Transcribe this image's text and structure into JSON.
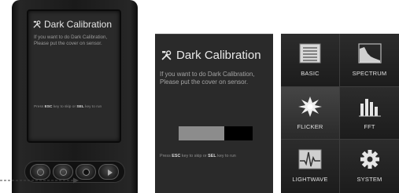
{
  "device_screen": {
    "title": "Dark  Calibration",
    "message": "If you want to do Dark Calibration, Please put the cover on sensor.",
    "hint": {
      "press": "Press ",
      "esc_key": "ESC",
      "middle": " key to skip or ",
      "sel_key": "SEL",
      "end": " key to run"
    }
  },
  "calibration_panel": {
    "title": "Dark  Calibration",
    "message": "If you want to do Dark Calibration, Please put the cover on sensor.",
    "progress": 0.62,
    "hint": {
      "press": "Press ",
      "esc_key": "ESC",
      "middle": " key to skip or ",
      "sel_key": "SEL",
      "end": " key to run"
    }
  },
  "menu": {
    "items": [
      {
        "label": "BASIC",
        "icon": "list-icon"
      },
      {
        "label": "SPECTRUM",
        "icon": "spectrum-icon"
      },
      {
        "label": "FLICKER",
        "icon": "flicker-icon"
      },
      {
        "label": "FFT",
        "icon": "fft-icon"
      },
      {
        "label": "LIGHTWAVE",
        "icon": "lightwave-icon"
      },
      {
        "label": "SYSTEM",
        "icon": "gear-icon"
      }
    ]
  },
  "colors": {
    "panel_bg": "#2a2a2a",
    "progress_fill": "#8c8c8c",
    "progress_track": "#000000"
  }
}
